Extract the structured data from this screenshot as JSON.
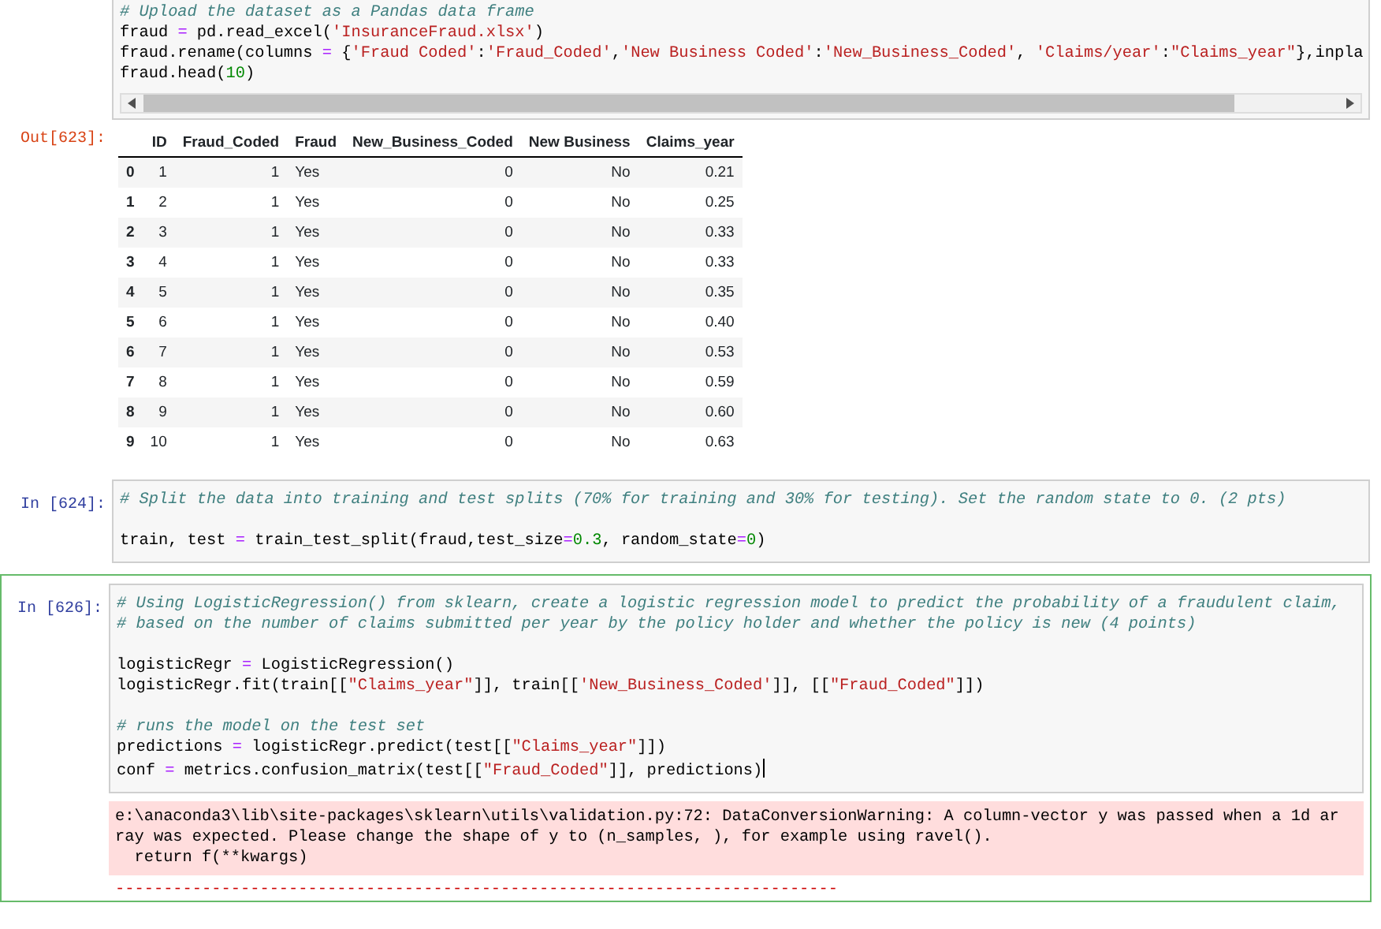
{
  "cells": [
    {
      "kind": "code",
      "selected": false,
      "scrollbar": true,
      "blocks": [
        [
          [
            {
              "kind": "comment",
              "text": "# Upload the dataset as a Pandas data frame"
            }
          ],
          [
            {
              "kind": "plain",
              "text": "fraud "
            },
            {
              "kind": "operator",
              "text": "="
            },
            {
              "kind": "plain",
              "text": " pd.read_excel("
            },
            {
              "kind": "string",
              "text": "'InsuranceFraud.xlsx'"
            },
            {
              "kind": "plain",
              "text": ")"
            }
          ],
          [
            {
              "kind": "plain",
              "text": "fraud.rename(columns "
            },
            {
              "kind": "operator",
              "text": "="
            },
            {
              "kind": "plain",
              "text": " {"
            },
            {
              "kind": "string",
              "text": "'Fraud Coded'"
            },
            {
              "kind": "plain",
              "text": ":"
            },
            {
              "kind": "string",
              "text": "'Fraud_Coded'"
            },
            {
              "kind": "plain",
              "text": ","
            },
            {
              "kind": "string",
              "text": "'New Business Coded'"
            },
            {
              "kind": "plain",
              "text": ":"
            },
            {
              "kind": "string",
              "text": "'New_Business_Coded'"
            },
            {
              "kind": "plain",
              "text": ", "
            },
            {
              "kind": "string",
              "text": "'Claims/year'"
            },
            {
              "kind": "plain",
              "text": ":"
            },
            {
              "kind": "string",
              "text": "\"Claims_year\""
            },
            {
              "kind": "plain",
              "text": "},inpla"
            }
          ],
          [
            {
              "kind": "plain",
              "text": "fraud.head("
            },
            {
              "kind": "number",
              "text": "10"
            },
            {
              "kind": "plain",
              "text": ")"
            }
          ]
        ]
      ]
    },
    {
      "kind": "table",
      "prompt": "Out[623]:",
      "columns": [
        "",
        "ID",
        "Fraud_Coded",
        "Fraud",
        "New_Business_Coded",
        "New Business",
        "Claims_year"
      ],
      "rows": [
        [
          "0",
          "1",
          "1",
          "Yes",
          "0",
          "No",
          "0.21"
        ],
        [
          "1",
          "2",
          "1",
          "Yes",
          "0",
          "No",
          "0.25"
        ],
        [
          "2",
          "3",
          "1",
          "Yes",
          "0",
          "No",
          "0.33"
        ],
        [
          "3",
          "4",
          "1",
          "Yes",
          "0",
          "No",
          "0.33"
        ],
        [
          "4",
          "5",
          "1",
          "Yes",
          "0",
          "No",
          "0.35"
        ],
        [
          "5",
          "6",
          "1",
          "Yes",
          "0",
          "No",
          "0.40"
        ],
        [
          "6",
          "7",
          "1",
          "Yes",
          "0",
          "No",
          "0.53"
        ],
        [
          "7",
          "8",
          "1",
          "Yes",
          "0",
          "No",
          "0.59"
        ],
        [
          "8",
          "9",
          "1",
          "Yes",
          "0",
          "No",
          "0.60"
        ],
        [
          "9",
          "10",
          "1",
          "Yes",
          "0",
          "No",
          "0.63"
        ]
      ]
    },
    {
      "kind": "code",
      "prompt": "In [624]:",
      "selected": false,
      "blocks": [
        [
          [
            {
              "kind": "comment",
              "text": "# Split the data into training and test splits (70% for training and 30% for testing). Set the random state to 0. (2 pts)"
            }
          ]
        ],
        [
          [
            {
              "kind": "plain",
              "text": "train, test "
            },
            {
              "kind": "operator",
              "text": "="
            },
            {
              "kind": "plain",
              "text": " train_test_split(fraud,test_size"
            },
            {
              "kind": "operator",
              "text": "="
            },
            {
              "kind": "number",
              "text": "0.3"
            },
            {
              "kind": "plain",
              "text": ", random_state"
            },
            {
              "kind": "operator",
              "text": "="
            },
            {
              "kind": "number",
              "text": "0"
            },
            {
              "kind": "plain",
              "text": ")"
            }
          ]
        ]
      ]
    },
    {
      "kind": "code",
      "prompt": "In [626]:",
      "selected": true,
      "cursor": true,
      "blocks": [
        [
          [
            {
              "kind": "comment",
              "text": "# Using LogisticRegression() from sklearn, create a logistic regression model to predict the probability of a fraudulent claim,"
            }
          ],
          [
            {
              "kind": "comment",
              "text": "# based on the number of claims submitted per year by the policy holder and whether the policy is new (4 points)"
            }
          ]
        ],
        [
          [
            {
              "kind": "plain",
              "text": "logisticRegr "
            },
            {
              "kind": "operator",
              "text": "="
            },
            {
              "kind": "plain",
              "text": " LogisticRegression()"
            }
          ],
          [
            {
              "kind": "plain",
              "text": "logisticRegr.fit(train[["
            },
            {
              "kind": "string",
              "text": "\"Claims_year\""
            },
            {
              "kind": "plain",
              "text": "]], train[["
            },
            {
              "kind": "string",
              "text": "'New_Business_Coded'"
            },
            {
              "kind": "plain",
              "text": "]], [["
            },
            {
              "kind": "string",
              "text": "\"Fraud_Coded\""
            },
            {
              "kind": "plain",
              "text": "]])"
            }
          ]
        ],
        [
          [
            {
              "kind": "comment",
              "text": "# runs the model on the test set"
            }
          ],
          [
            {
              "kind": "plain",
              "text": "predictions "
            },
            {
              "kind": "operator",
              "text": "="
            },
            {
              "kind": "plain",
              "text": " logisticRegr.predict(test[["
            },
            {
              "kind": "string",
              "text": "\"Claims_year\""
            },
            {
              "kind": "plain",
              "text": "]])"
            }
          ],
          [
            {
              "kind": "plain",
              "text": "conf "
            },
            {
              "kind": "operator",
              "text": "="
            },
            {
              "kind": "plain",
              "text": " metrics.confusion_matrix(test[["
            },
            {
              "kind": "string",
              "text": "\"Fraud_Coded\""
            },
            {
              "kind": "plain",
              "text": "]], predictions)"
            }
          ]
        ]
      ],
      "stderr": [
        "e:\\anaconda3\\lib\\site-packages\\sklearn\\utils\\validation.py:72: DataConversionWarning: A column-vector y was passed when a 1d ar",
        "ray was expected. Please change the shape of y to (n_samples, ), for example using ravel().",
        "  return f(**kwargs)"
      ],
      "traceback": "---------------------------------------------------------------------------"
    }
  ]
}
